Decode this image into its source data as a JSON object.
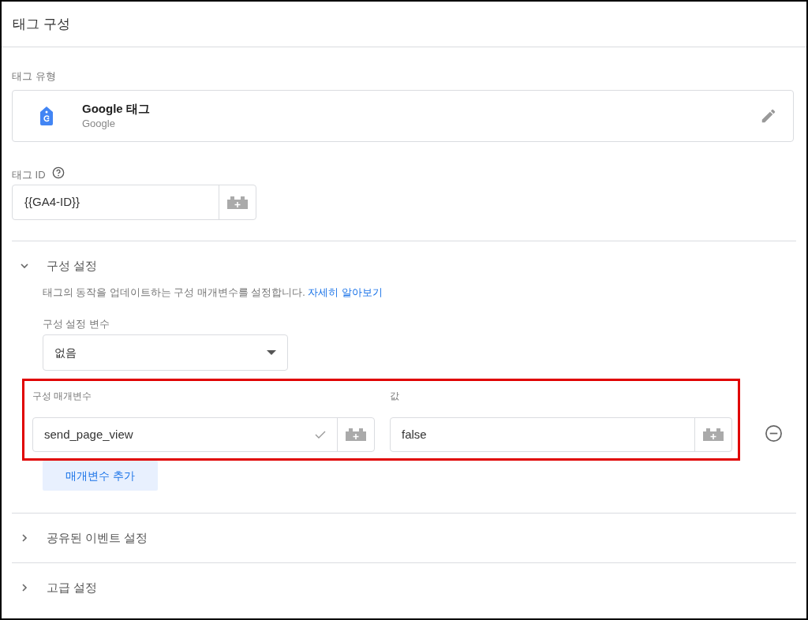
{
  "panel": {
    "title": "태그 구성"
  },
  "tag_type": {
    "label": "태그 유형",
    "name": "Google 태그",
    "vendor": "Google"
  },
  "tag_id": {
    "label": "태그 ID",
    "value": "{{GA4-ID}}"
  },
  "sections": [
    {
      "title": "구성 설정",
      "expanded": true,
      "description": "태그의 동작을 업데이트하는 구성 매개변수를 설정합니다.",
      "link": "자세히 알아보기",
      "variable_label": "구성 설정 변수",
      "variable_value": "없음",
      "highlighted": true,
      "param_header": "구성 매개변수",
      "value_header": "값",
      "rows": [
        {
          "name": "send_page_view",
          "value": "false",
          "valid": true
        }
      ],
      "add_button": "매개변수 추가"
    },
    {
      "title": "공유된 이벤트 설정",
      "expanded": false
    },
    {
      "title": "고급 설정",
      "expanded": false
    }
  ]
}
